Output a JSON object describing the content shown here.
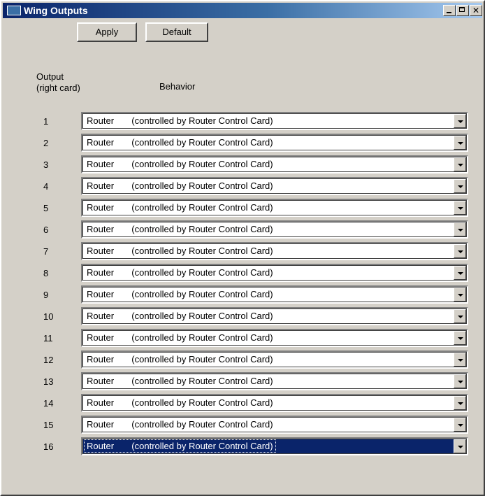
{
  "window": {
    "title": "Wing Outputs"
  },
  "toolbar": {
    "apply_label": "Apply",
    "default_label": "Default"
  },
  "headers": {
    "output_line1": "Output",
    "output_line2": "(right card)",
    "behavior": "Behavior"
  },
  "rows": [
    {
      "num": "1",
      "value": "Router       (controlled by Router Control Card)"
    },
    {
      "num": "2",
      "value": "Router       (controlled by Router Control Card)"
    },
    {
      "num": "3",
      "value": "Router       (controlled by Router Control Card)"
    },
    {
      "num": "4",
      "value": "Router       (controlled by Router Control Card)"
    },
    {
      "num": "5",
      "value": "Router       (controlled by Router Control Card)"
    },
    {
      "num": "6",
      "value": "Router       (controlled by Router Control Card)"
    },
    {
      "num": "7",
      "value": "Router       (controlled by Router Control Card)"
    },
    {
      "num": "8",
      "value": "Router       (controlled by Router Control Card)"
    },
    {
      "num": "9",
      "value": "Router       (controlled by Router Control Card)"
    },
    {
      "num": "10",
      "value": "Router       (controlled by Router Control Card)"
    },
    {
      "num": "11",
      "value": "Router       (controlled by Router Control Card)"
    },
    {
      "num": "12",
      "value": "Router       (controlled by Router Control Card)"
    },
    {
      "num": "13",
      "value": "Router       (controlled by Router Control Card)"
    },
    {
      "num": "14",
      "value": "Router       (controlled by Router Control Card)"
    },
    {
      "num": "15",
      "value": "Router       (controlled by Router Control Card)"
    },
    {
      "num": "16",
      "value": "Router       (controlled by Router Control Card)",
      "selected": true
    }
  ]
}
